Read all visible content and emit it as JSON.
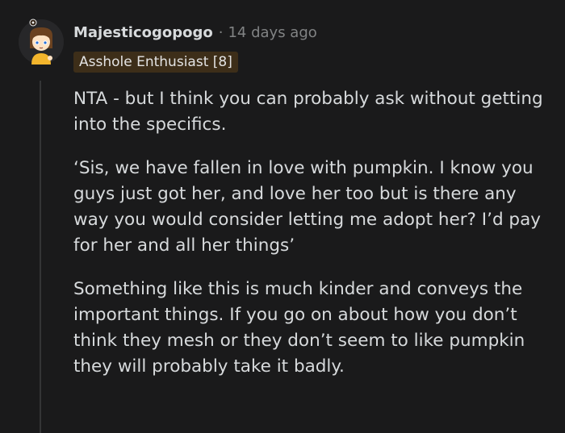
{
  "comment": {
    "username": "Majesticogopogo",
    "separator": "·",
    "timestamp": "14 days ago",
    "flair": "Asshole Enthusiast [8]",
    "avatar_icon": "cartoon-girl-avatar-icon",
    "paragraphs": [
      "NTA - but I think you can probably ask without getting into the specifics.",
      "‘Sis, we have fallen in love with pumpkin. I know you guys just got her, and love her too but is there any way you would consider letting me adopt her? I’d pay for her and all her things’",
      "Something like this is much kinder and conveys the important things. If you go on about how you don’t think they mesh or they don’t seem to like pumpkin they will probably take it badly."
    ]
  },
  "colors": {
    "background": "#1a1a1b",
    "text": "#d7dadc",
    "muted": "#818384",
    "flair_bg": "#3d2e19",
    "thread_line": "#343536"
  }
}
